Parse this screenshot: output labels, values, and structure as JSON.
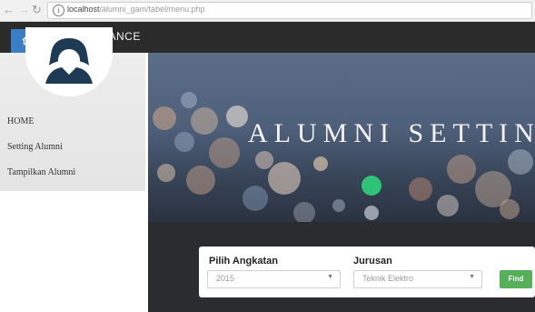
{
  "browser": {
    "url_host": "localhost",
    "url_path": "/alumni_gam/tabel/menu.php"
  },
  "header": {
    "title": "MAINTENANCE"
  },
  "sidebar": {
    "items": [
      {
        "label": "HOME"
      },
      {
        "label": "Setting Alumni"
      },
      {
        "label": "Tampilkan Alumni"
      }
    ]
  },
  "hero": {
    "title": "ALUMNI SETTIN"
  },
  "filter": {
    "angkatan_label": "Pilih Angkatan",
    "angkatan_value": "2015",
    "jurusan_label": "Jurusan",
    "jurusan_value": "Teknik Elektro",
    "find_label": "Find"
  },
  "colors": {
    "header_bg": "#2b2b2b",
    "home_button": "#3b7ec8",
    "find_button": "#56b05a",
    "band_bg": "#2a2c2f"
  },
  "icons": {
    "home_button": "home-icon",
    "avatar": "user-avatar-icon",
    "address_bar": "info-icon"
  }
}
